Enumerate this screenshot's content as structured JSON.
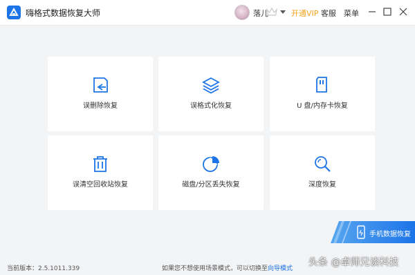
{
  "colors": {
    "accent": "#1c74e8",
    "vip": "#f0a21a",
    "background": "#f3f4f6"
  },
  "titlebar": {
    "app_icon": "app-logo-icon",
    "title": "嗨格式数据恢复大师",
    "username": "落儿",
    "vip_label": "开通VIP",
    "service_label": "客服",
    "menu_label": "菜单"
  },
  "cards": [
    {
      "label": "误删除恢复",
      "icon": "deleted-file-icon"
    },
    {
      "label": "误格式化恢复",
      "icon": "layers-icon"
    },
    {
      "label": "U 盘/内存卡恢复",
      "icon": "sd-card-icon"
    },
    {
      "label": "误清空回收站恢复",
      "icon": "trash-icon"
    },
    {
      "label": "磁盘/分区丢失恢复",
      "icon": "pie-chart-icon"
    },
    {
      "label": "深度恢复",
      "icon": "magnifier-icon"
    }
  ],
  "mobile_recovery": {
    "label": "手机数据恢复",
    "icon": "phone-icon"
  },
  "statusbar": {
    "version": "当前版本：2.5.1011.339",
    "hint": "如果您不想使用场景模式，可以切换至",
    "guide_link": "向导模式"
  },
  "watermark": "头条 @卓师兄谈科技"
}
